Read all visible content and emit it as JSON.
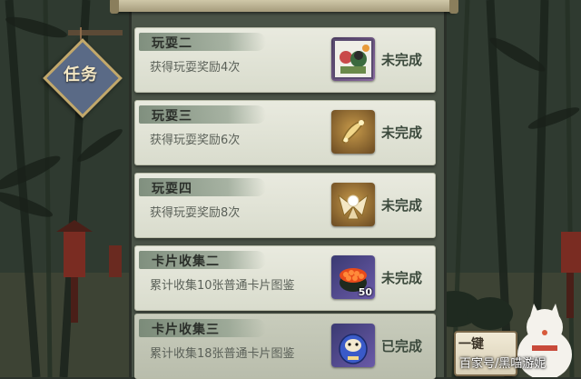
{
  "banner": {
    "label": "任务"
  },
  "tasks": [
    {
      "title": "玩耍二",
      "desc": "获得玩耍奖励4次",
      "status": "未完成",
      "reward_icon": "toy-card-icon",
      "reward_count": ""
    },
    {
      "title": "玩耍三",
      "desc": "获得玩耍奖励6次",
      "status": "未完成",
      "reward_icon": "gold-ornament-icon",
      "reward_count": ""
    },
    {
      "title": "玩耍四",
      "desc": "获得玩耍奖励8次",
      "status": "未完成",
      "reward_icon": "pearl-shell-icon",
      "reward_count": ""
    },
    {
      "title": "卡片收集二",
      "desc": "累计收集10张普通卡片图鉴",
      "status": "未完成",
      "reward_icon": "salmon-roe-sushi-icon",
      "reward_count": "50"
    },
    {
      "title": "卡片收集三",
      "desc": "累计收集18张普通卡片图鉴",
      "status": "已完成",
      "reward_icon": "daruma-doll-icon",
      "reward_count": ""
    }
  ],
  "onekey_label": "一键",
  "watermark": "百家号/黑喵游妮",
  "colors": {
    "card": "#e5e6da",
    "status": "#3c4a3d",
    "brush": "#6e806e"
  }
}
